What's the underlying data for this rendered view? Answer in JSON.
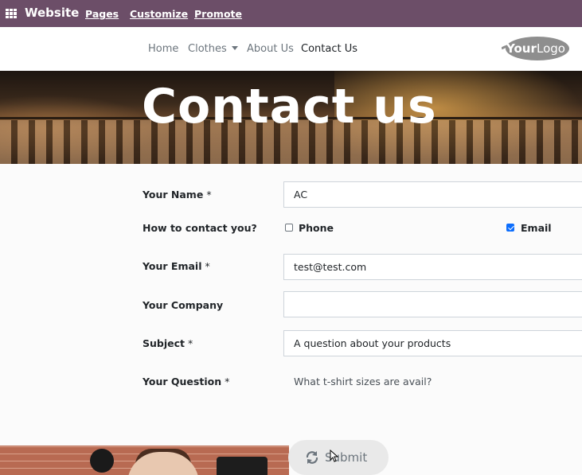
{
  "adminbar": {
    "title": "Website",
    "links": [
      "Pages",
      "Customize",
      "Promote"
    ]
  },
  "navbar": {
    "items": [
      {
        "label": "Home",
        "active": false
      },
      {
        "label": "Clothes",
        "active": false,
        "dropdown": true
      },
      {
        "label": "About Us",
        "active": false
      },
      {
        "label": "Contact Us",
        "active": true
      }
    ],
    "logo_text_bold": "Your",
    "logo_text_light": "Logo"
  },
  "hero": {
    "title": "Contact us"
  },
  "form": {
    "name_label": "Your Name",
    "name_value": "AC",
    "contact_label": "How to contact you?",
    "phone_label": "Phone",
    "phone_checked": false,
    "email_option_label": "Email",
    "email_option_checked": true,
    "email_label": "Your Email",
    "email_value": "test@test.com",
    "company_label": "Your Company",
    "company_value": "",
    "subject_label": "Subject",
    "subject_value": "A question about your products",
    "question_label": "Your Question",
    "question_value": "What t-shirt sizes are avail?",
    "required_mark": "*",
    "submit_label": "Submit"
  },
  "colors": {
    "adminbar": "#6c4e68",
    "checkbox_on": "#0d6efd"
  }
}
